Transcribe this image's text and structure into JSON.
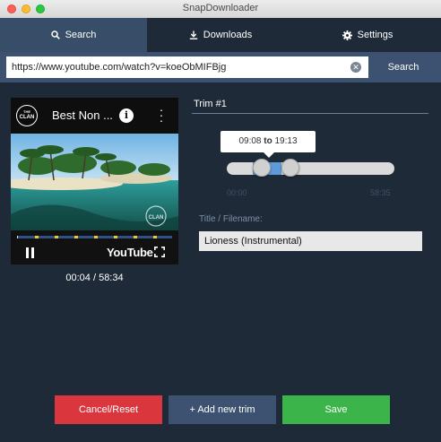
{
  "window": {
    "title": "SnapDownloader"
  },
  "tabs": [
    {
      "label": "Search",
      "icon": "search-icon",
      "active": true
    },
    {
      "label": "Downloads",
      "icon": "download-icon",
      "active": false
    },
    {
      "label": "Settings",
      "icon": "gear-icon",
      "active": false
    }
  ],
  "search": {
    "url_value": "https://www.youtube.com/watch?v=koeObMIFBjg",
    "button_label": "Search"
  },
  "video": {
    "title": "Best Non ...",
    "channel_logo_text": "CLAN",
    "brand": "YouTube",
    "watermark_text": "CLAN",
    "current_time": "00:04 / 58:34",
    "playback_fraction": 0.001
  },
  "trim": {
    "label": "Trim #1",
    "start": "09:08",
    "end": "19:13",
    "to_word": "to",
    "range_min": "00:00",
    "range_max": "58:35",
    "start_fraction": 0.156,
    "end_fraction": 0.328
  },
  "filename": {
    "label": "Title / Filename:",
    "value": "Lioness (Instrumental)"
  },
  "actions": {
    "cancel_label": "Cancel/Reset",
    "add_label": "+ Add new trim",
    "save_label": "Save"
  },
  "colors": {
    "background": "#1f2a38",
    "tab_active": "#384d67",
    "cancel": "#d9363e",
    "add": "#3c5270",
    "save": "#3bb54a",
    "slider_range": "#5d9bd8"
  }
}
